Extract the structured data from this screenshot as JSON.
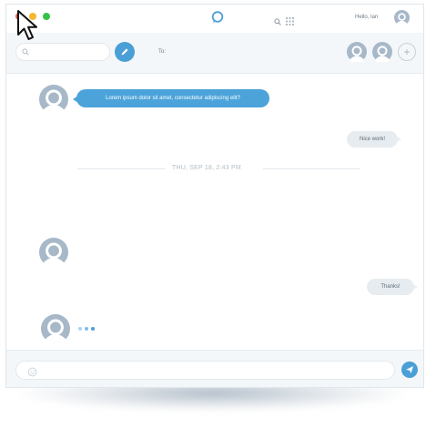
{
  "titlebar": {
    "greeting": "Hello, Ian",
    "icons": [
      "close-dot",
      "minimize-dot",
      "maximize-dot",
      "chat-bubble-icon",
      "search-icon",
      "grid-icon",
      "avatar"
    ]
  },
  "toolbar": {
    "search_placeholder": "",
    "to_label": "To:",
    "icons": [
      "search-icon",
      "compose-pencil-icon",
      "avatar",
      "avatar",
      "add-icon"
    ]
  },
  "conversation": {
    "messages": [
      {
        "direction": "outgoing-blue",
        "text": "Lorem ipsum dolor sit amet, consectetur adipiscing elit?"
      },
      {
        "direction": "incoming-gray",
        "text": "Nice work!"
      },
      {
        "direction": "incoming-gray",
        "text": "Thanks!"
      }
    ],
    "date_separator": "THU, SEP 18, 2:43 PM",
    "typing_indicator_dots": 3
  },
  "composer": {
    "placeholder": "",
    "icons": [
      "emoji-icon",
      "send-icon"
    ]
  },
  "colors": {
    "accent": "#4a9fd6",
    "bubble_blue": "#4ba3da",
    "bubble_gray": "#e7ecf0",
    "avatar": "#a7b8c8",
    "close": "#ed5b5b",
    "minimize": "#f5b731",
    "maximize": "#35c24a"
  }
}
